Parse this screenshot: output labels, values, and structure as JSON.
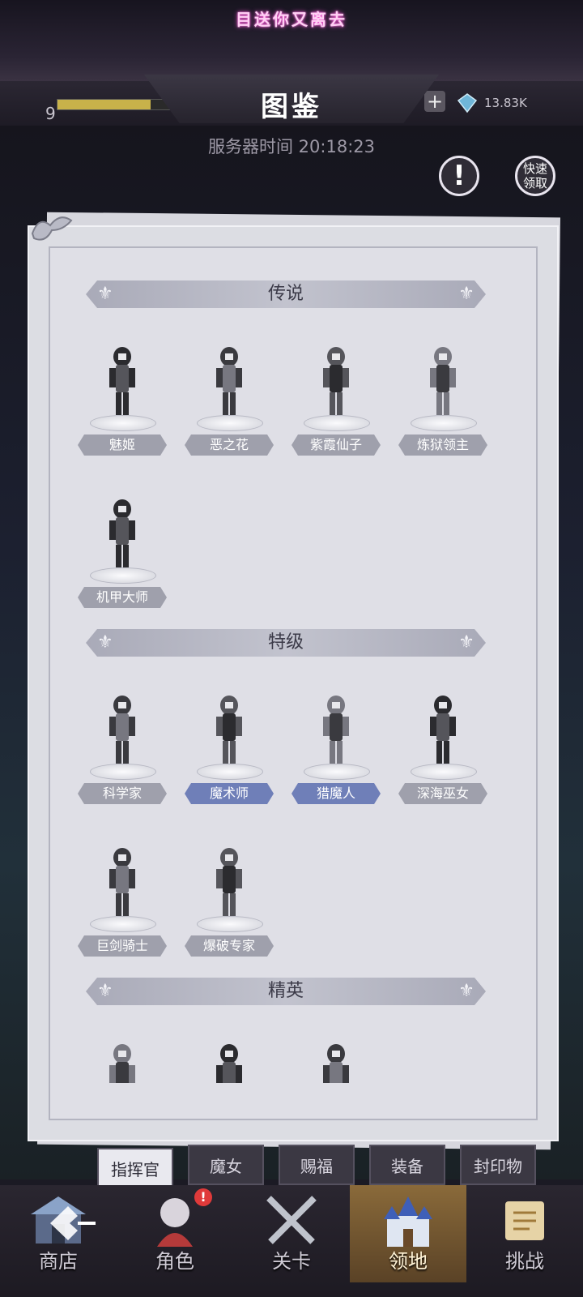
{
  "banner": {
    "text": "目送你又离去"
  },
  "hud": {
    "level": "9",
    "xp_progress": 0.82,
    "gems": "13.83K"
  },
  "header": {
    "title": "图鉴",
    "server_time_label": "服务器时间 20:18:23"
  },
  "buttons": {
    "info_icon": "exclamation-icon",
    "quick_claim": "快速领取"
  },
  "sections": [
    {
      "title": "传说",
      "cards": [
        {
          "name": "魅姬",
          "tag": "gray"
        },
        {
          "name": "恶之花",
          "tag": "gray"
        },
        {
          "name": "紫霞仙子",
          "tag": "gray"
        },
        {
          "name": "炼狱领主",
          "tag": "gray"
        },
        {
          "name": "机甲大师",
          "tag": "gray"
        }
      ]
    },
    {
      "title": "特级",
      "cards": [
        {
          "name": "科学家",
          "tag": "gray"
        },
        {
          "name": "魔术师",
          "tag": "blue"
        },
        {
          "name": "猎魔人",
          "tag": "blue"
        },
        {
          "name": "深海巫女",
          "tag": "gray"
        },
        {
          "name": "巨剑骑士",
          "tag": "gray"
        },
        {
          "name": "爆破专家",
          "tag": "gray"
        }
      ]
    },
    {
      "title": "精英",
      "cards": []
    }
  ],
  "category_tabs": [
    "指挥官",
    "魔女",
    "赐福",
    "装备",
    "封印物"
  ],
  "active_category": "指挥官",
  "nav": [
    {
      "label": "商店",
      "icon": "shop-icon"
    },
    {
      "label": "角色",
      "icon": "character-icon",
      "badge": "!"
    },
    {
      "label": "关卡",
      "icon": "crossed-swords-icon"
    },
    {
      "label": "领地",
      "icon": "castle-icon"
    },
    {
      "label": "挑战",
      "icon": "scroll-icon"
    }
  ],
  "active_nav": "领地",
  "colors": {
    "accent_blue_tag": "#6f7fb8",
    "gray_tag": "#9fa0ac",
    "active_nav": "#8a6a3a"
  }
}
